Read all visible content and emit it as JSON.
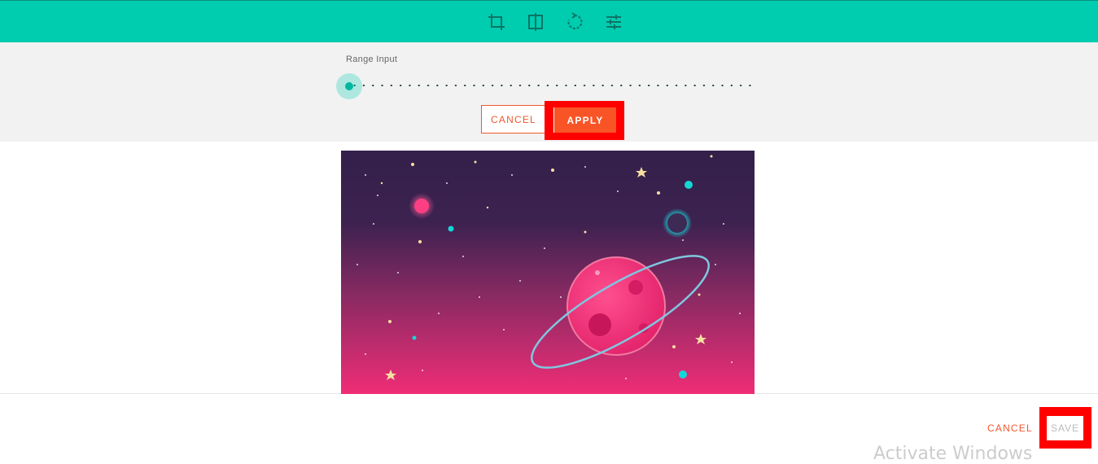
{
  "toolbar": {
    "tools": [
      {
        "name": "crop-icon"
      },
      {
        "name": "flip-icon"
      },
      {
        "name": "rotate-icon"
      },
      {
        "name": "adjust-icon"
      }
    ],
    "background_color": "#00ccb0"
  },
  "settings_panel": {
    "range_label": "Range Input",
    "range_value": 0,
    "cancel_label": "CANCEL",
    "apply_label": "APPLY"
  },
  "footer": {
    "cancel_label": "CANCEL",
    "save_label": "SAVE",
    "watermark_text": "Activate Windows"
  },
  "colors": {
    "accent": "#00ccb0",
    "action": "#f85426",
    "highlight": "#ff0000"
  }
}
